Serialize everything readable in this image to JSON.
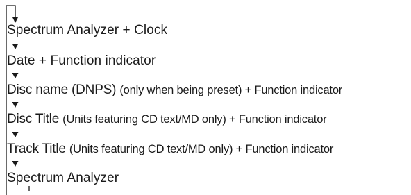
{
  "flow": {
    "steps": [
      {
        "main": "Spectrum Analyzer + Clock",
        "sub": ""
      },
      {
        "main": "Date + Function indicator",
        "sub": ""
      },
      {
        "main": "Disc name (DNPS) ",
        "sub": "(only when being preset) + Function indicator"
      },
      {
        "main": "Disc Title ",
        "sub": "(Units featuring CD text/MD only) + Function indicator"
      },
      {
        "main": "Track Title ",
        "sub": "(Units featuring CD text/MD only) + Function indicator"
      },
      {
        "main": "Spectrum Analyzer",
        "sub": ""
      }
    ],
    "cycle": "loops back to first step",
    "line_color": "#1a1a1a"
  }
}
